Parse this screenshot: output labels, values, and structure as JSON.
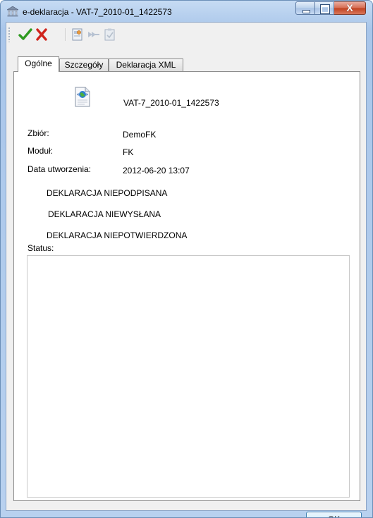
{
  "window": {
    "title": "e-deklaracja - VAT-7_2010-01_1422573",
    "close_glyph": "X"
  },
  "toolbar": {
    "icons": [
      "accept-check-icon",
      "cancel-x-icon",
      "sign-certificate-icon",
      "send-arrows-icon",
      "confirm-clipboard-icon"
    ]
  },
  "tabs": [
    {
      "label": "Ogólne"
    },
    {
      "label": "Szczegóły"
    },
    {
      "label": "Deklaracja XML"
    }
  ],
  "general": {
    "document_name": "VAT-7_2010-01_1422573",
    "fields": [
      {
        "label": "Zbiór:",
        "value": "DemoFK"
      },
      {
        "label": "Moduł:",
        "value": "FK"
      },
      {
        "label": "Data utworzenia:",
        "value": "2012-06-20 13:07"
      }
    ],
    "states": [
      "DEKLARACJA NIEPODPISANA",
      "DEKLARACJA NIEWYSŁANA",
      "DEKLARACJA NIEPOTWIERDZONA"
    ],
    "status_label": "Status:",
    "status_text": ""
  },
  "footer": {
    "ok_label": "OK"
  },
  "colors": {
    "accept_green": "#2e9a1f",
    "cancel_red": "#d0241c",
    "frame_blue": "#b8d1ef"
  }
}
